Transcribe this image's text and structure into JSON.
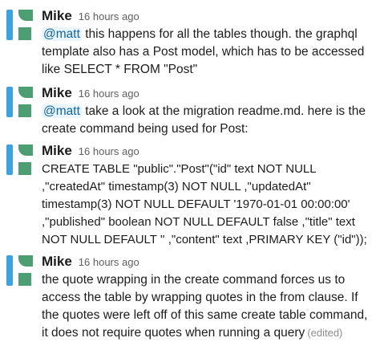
{
  "messages": [
    {
      "author": "Mike",
      "time": "16 hours ago",
      "mention": "@matt",
      "text": " this happens for all the tables though. the graphql template also has a Post model, which has to be accessed like SELECT * FROM \"Post\""
    },
    {
      "author": "Mike",
      "time": "16 hours ago",
      "mention": "@matt",
      "text": " take a look at the migration readme.md. here is the create command being used for Post:"
    },
    {
      "author": "Mike",
      "time": "16 hours ago",
      "text": "CREATE TABLE \"public\".\"Post\"(\"id\" text NOT NULL\n,\"createdAt\" timestamp(3) NOT NULL  ,\"updatedAt\"\ntimestamp(3) NOT NULL DEFAULT '1970-01-01 00:00:00'\n,\"published\" boolean NOT NULL DEFAULT false ,\"title\" text\nNOT NULL DEFAULT '' ,\"content\" text    ,PRIMARY KEY (\"id\"));"
    },
    {
      "author": "Mike",
      "time": "16 hours ago",
      "text": "the quote wrapping in the create command forces us to access the table by wrapping quotes in the from clause. If the quotes were left off of this same create table command, it does not require quotes when running a query",
      "edited": "(edited)"
    }
  ]
}
